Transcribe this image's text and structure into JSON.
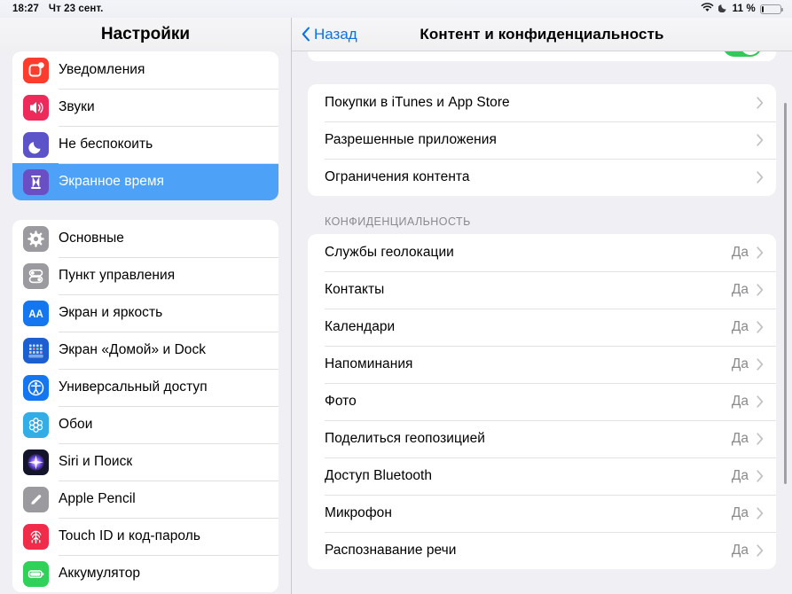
{
  "statusbar": {
    "time": "18:27",
    "date": "Чт 23 сент.",
    "wifi_icon": "wifi-icon",
    "dnd_icon": "moon-icon",
    "battery_percent": "11 %",
    "battery_icon": "battery-icon",
    "battery_level": 11
  },
  "sidebar": {
    "title": "Настройки",
    "groups": [
      {
        "items": [
          {
            "label": "Уведомления",
            "icon": "notifications-icon",
            "color": "#fc3c2d",
            "selected": false
          },
          {
            "label": "Звуки",
            "icon": "sounds-icon",
            "color": "#ee2a5b",
            "selected": false
          },
          {
            "label": "Не беспокоить",
            "icon": "moon-icon",
            "color": "#5c53c9",
            "selected": false
          },
          {
            "label": "Экранное время",
            "icon": "hourglass-icon",
            "color": "#6a4ec4",
            "selected": true
          }
        ]
      },
      {
        "items": [
          {
            "label": "Основные",
            "icon": "gear-icon",
            "color": "#9a9a9f",
            "selected": false
          },
          {
            "label": "Пункт управления",
            "icon": "sliders-icon",
            "color": "#9a9a9f",
            "selected": false
          },
          {
            "label": "Экран и яркость",
            "icon": "display-aa-icon",
            "color": "#1477f0",
            "selected": false
          },
          {
            "label": "Экран «Домой» и Dock",
            "icon": "homescreen-icon",
            "color": "#1b5fd0",
            "selected": false
          },
          {
            "label": "Универсальный доступ",
            "icon": "accessibility-icon",
            "color": "#1477f0",
            "selected": false
          },
          {
            "label": "Обои",
            "icon": "wallpaper-icon",
            "color": "#32ade6",
            "selected": false
          },
          {
            "label": "Siri и Поиск",
            "icon": "siri-icon",
            "color": "#1a1a2e",
            "selected": false
          },
          {
            "label": "Apple Pencil",
            "icon": "pencil-icon",
            "color": "#9a9a9f",
            "selected": false
          },
          {
            "label": "Touch ID и код-пароль",
            "icon": "fingerprint-icon",
            "color": "#f02c4a",
            "selected": false
          },
          {
            "label": "Аккумулятор",
            "icon": "battery-icon",
            "color": "#30d158",
            "selected": false
          }
        ]
      }
    ]
  },
  "detail": {
    "back_label": "Назад",
    "back_icon": "chevron-left-icon",
    "title": "Контент и конфиденциальность",
    "clipped_toggle": {
      "name": "content-privacy-toggle",
      "state": "on",
      "color": "#34c759"
    },
    "restrictions_group": {
      "rows": [
        {
          "label": "Покупки в iTunes и App Store",
          "value": "",
          "chevron": "chevron-right-icon"
        },
        {
          "label": "Разрешенные приложения",
          "value": "",
          "chevron": "chevron-right-icon"
        },
        {
          "label": "Ограничения контента",
          "value": "",
          "chevron": "chevron-right-icon"
        }
      ]
    },
    "privacy_section": {
      "header": "КОНФИДЕНЦИАЛЬНОСТЬ",
      "rows": [
        {
          "label": "Службы геолокации",
          "value": "Да",
          "chevron": "chevron-right-icon"
        },
        {
          "label": "Контакты",
          "value": "Да",
          "chevron": "chevron-right-icon"
        },
        {
          "label": "Календари",
          "value": "Да",
          "chevron": "chevron-right-icon"
        },
        {
          "label": "Напоминания",
          "value": "Да",
          "chevron": "chevron-right-icon"
        },
        {
          "label": "Фото",
          "value": "Да",
          "chevron": "chevron-right-icon"
        },
        {
          "label": "Поделиться геопозицией",
          "value": "Да",
          "chevron": "chevron-right-icon"
        },
        {
          "label": "Доступ Bluetooth",
          "value": "Да",
          "chevron": "chevron-right-icon"
        },
        {
          "label": "Микрофон",
          "value": "Да",
          "chevron": "chevron-right-icon"
        },
        {
          "label": "Распознавание речи",
          "value": "Да",
          "chevron": "chevron-right-icon"
        }
      ]
    },
    "scrollbar": {
      "name": "detail-scrollbar"
    }
  },
  "colors": {
    "accent": "#0b72e8",
    "selection": "#4da2f7",
    "page_bg": "#efeff4",
    "card_bg": "#ffffff",
    "secondary_text": "#8a8a8e"
  }
}
